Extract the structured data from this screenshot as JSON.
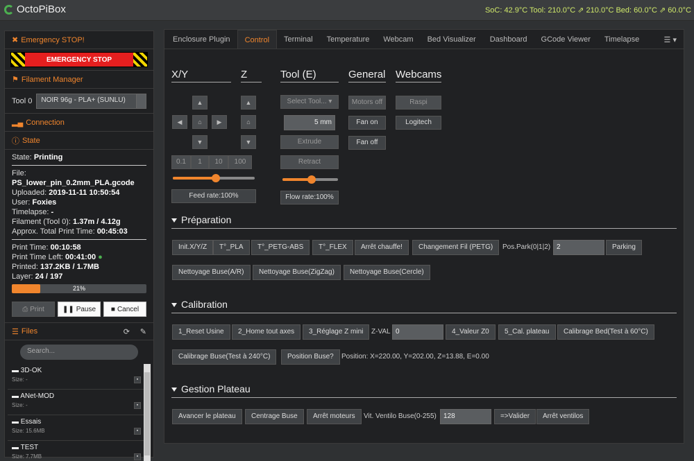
{
  "app": {
    "title": "OctoPiBox",
    "status": "SoC: 42.9°C Tool: 210.0°C ⇗ 210.0°C Bed: 60.0°C ⇗ 60.0°C"
  },
  "sidebar": {
    "emergency_head": "Emergency STOP!",
    "emergency_button": "EMERGENCY STOP",
    "filament_head": "Filament Manager",
    "tool_label": "Tool 0",
    "tool_select": "NOIR 96g - PLA+ (SUNLU)",
    "connection_head": "Connection",
    "state_head": "State",
    "state": {
      "label": "State:",
      "value": "Printing"
    },
    "file": {
      "label": "File:",
      "value": "PS_lower_pin_0.2mm_PLA.gcode"
    },
    "uploaded": {
      "label": "Uploaded:",
      "value": "2019-11-11 10:50:54"
    },
    "user": {
      "label": "User:",
      "value": "Foxies"
    },
    "timelapse": {
      "label": "Timelapse:",
      "value": "-"
    },
    "filament": {
      "label": "Filament (Tool 0):",
      "value": "1.37m / 4.12g"
    },
    "approx": {
      "label": "Approx. Total Print Time:",
      "value": "00:45:03"
    },
    "print_time": {
      "label": "Print Time:",
      "value": "00:10:58"
    },
    "time_left": {
      "label": "Print Time Left:",
      "value": "00:41:00"
    },
    "printed": {
      "label": "Printed:",
      "value": "137.2KB / 1.7MB"
    },
    "layer": {
      "label": "Layer:",
      "value": "24 / 197"
    },
    "progress": {
      "percent": 21,
      "label": "21%"
    },
    "print_btn": "Print",
    "pause_btn": "Pause",
    "cancel_btn": "Cancel",
    "files_head": "Files",
    "search_placeholder": "Search...",
    "files": [
      {
        "name": "3D-OK",
        "size": "Size: -"
      },
      {
        "name": "ANet-MOD",
        "size": "Size: -"
      },
      {
        "name": "Essais",
        "size": "Size: 15.6MB"
      },
      {
        "name": "TEST",
        "size": "Size: 7.7MB"
      }
    ]
  },
  "tabs": [
    "Enclosure Plugin",
    "Control",
    "Terminal",
    "Temperature",
    "Webcam",
    "Bed Visualizer",
    "Dashboard",
    "GCode Viewer",
    "Timelapse"
  ],
  "control": {
    "xy": "X/Y",
    "z": "Z",
    "tool": "Tool (E)",
    "general": "General",
    "webcams": "Webcams",
    "steps": [
      "0.1",
      "1",
      "10",
      "100"
    ],
    "feed": "Feed rate:100%",
    "flow": "Flow rate:100%",
    "select_tool": "Select Tool...",
    "mm_value": "5",
    "mm_unit": "mm",
    "extrude": "Extrude",
    "retract": "Retract",
    "motors_off": "Motors off",
    "fan_on": "Fan on",
    "fan_off": "Fan off",
    "raspi": "Raspi",
    "logitech": "Logitech"
  },
  "prep": {
    "title": "Préparation",
    "b1": "Init.X/Y/Z",
    "b2": "T°_PLA",
    "b3": "T°_PETG-ABS",
    "b4": "T°_FLEX",
    "b5": "Arrêt chauffe!",
    "b6": "Changement Fil (PETG)",
    "pos_label": "Pos.Park(0|1|2)",
    "pos_value": "2",
    "parking": "Parking",
    "n1": "Nettoyage Buse(A/R)",
    "n2": "Nettoyage Buse(ZigZag)",
    "n3": "Nettoyage Buse(Cercle)"
  },
  "calib": {
    "title": "Calibration",
    "b1": "1_Reset Usine",
    "b2": "2_Home tout axes",
    "b3": "3_Réglage Z mini",
    "zval_label": "Z-VAL",
    "zval_value": "0",
    "b4": "4_Valeur Z0",
    "b5": "5_Cal. plateau",
    "b6": "Calibrage Bed(Test à 60°C)",
    "b7": "Calibrage Buse(Test à 240°C)",
    "b8": "Position Buse?",
    "position": "Position: X=220.00, Y=202.00, Z=13.88, E=0.00"
  },
  "plateau": {
    "title": "Gestion Plateau",
    "b1": "Avancer le plateau",
    "b2": "Centrage Buse",
    "b3": "Arrêt moteurs",
    "vit_label": "Vit. Ventilo Buse(0-255)",
    "vit_value": "128",
    "valider": "=>Valider",
    "stop": "Arrêt ventilos"
  }
}
